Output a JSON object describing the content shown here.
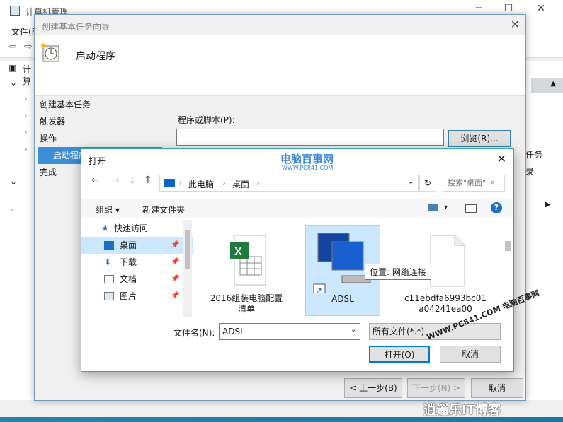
{
  "mmc": {
    "title": "计算机管理",
    "menu_file": "文件(F)",
    "tree_root": "计算",
    "right_text_1": "任务",
    "right_text_2": "录"
  },
  "wizard": {
    "title": "创建基本任务向导",
    "header_title": "启动程序",
    "steps": [
      "创建基本任务",
      "触发器",
      "操作",
      "启动程序",
      "完成"
    ],
    "program_label": "程序或脚本(P):",
    "program_value": "",
    "browse_label": "浏览(R)...",
    "back_label": "< 上一步(B)",
    "next_label": "下一步(N) >",
    "cancel_label": "取消"
  },
  "open_dialog": {
    "title": "打开",
    "breadcrumb": [
      "此电脑",
      "桌面"
    ],
    "search_placeholder": "搜索\"桌面\"",
    "organize_label": "组织 ▾",
    "new_folder_label": "新建文件夹",
    "nav_items": [
      {
        "label": "快速访问",
        "icon": "star-icon",
        "selected": false
      },
      {
        "label": "桌面",
        "icon": "desktop-icon",
        "selected": true
      },
      {
        "label": "下载",
        "icon": "download-icon",
        "selected": false
      },
      {
        "label": "文档",
        "icon": "document-icon",
        "selected": false
      },
      {
        "label": "图片",
        "icon": "picture-icon",
        "selected": false
      }
    ],
    "files": [
      {
        "name": "2016组装电脑配置清单",
        "icon": "excel-icon",
        "selected": false
      },
      {
        "name": "ADSL",
        "icon": "network-connection-icon",
        "selected": true
      },
      {
        "name": "c11ebdfa6993bc01a04241ea00",
        "icon": "file-icon",
        "selected": false
      }
    ],
    "tooltip": "位置: 网络连接",
    "filename_label": "文件名(N):",
    "filename_value": "ADSL",
    "filetype_value": "所有文件(*.*)",
    "open_label": "打开(O)",
    "cancel_label": "取消"
  },
  "watermarks": {
    "top_brand": "电脑百事网",
    "top_url": "WWW.PC841.COM",
    "diag_text": "WWW.PC841.COM 电脑百事网",
    "bottom_brand": "逍遥乐IT博客"
  },
  "colors": {
    "accent": "#3c8fd4",
    "selection": "#cce8ff",
    "dialog_border": "#3aa6a0"
  }
}
